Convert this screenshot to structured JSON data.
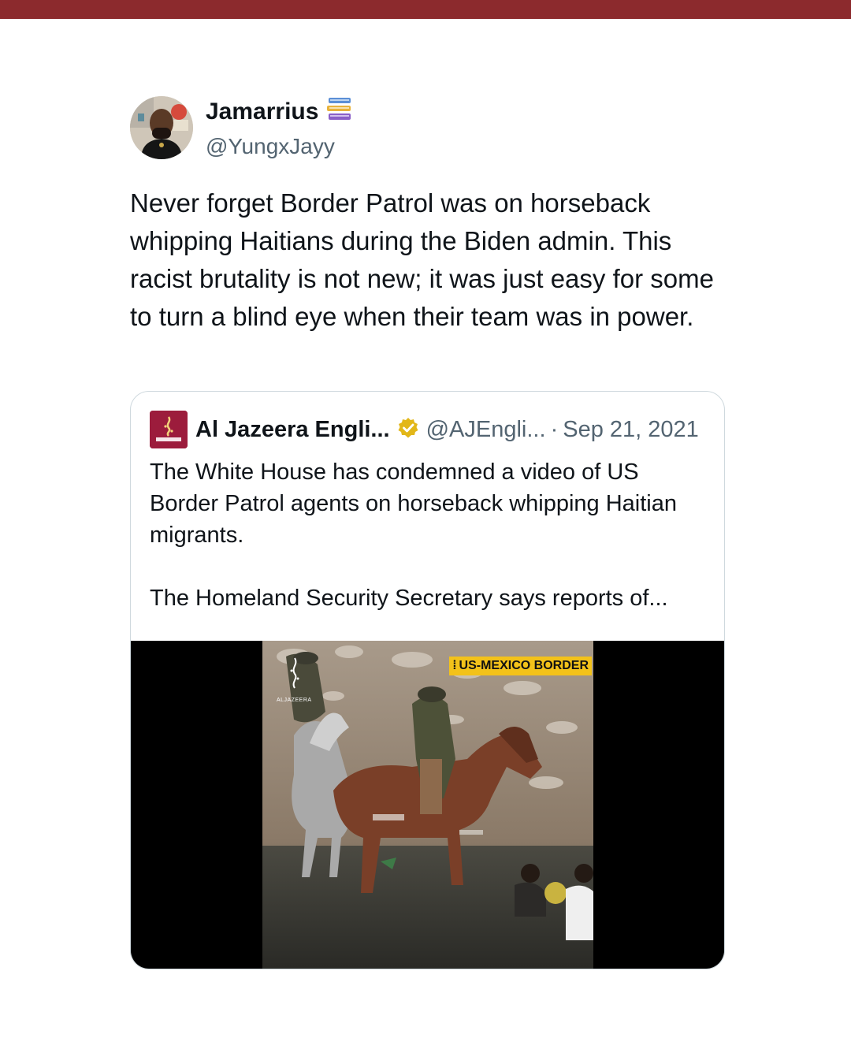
{
  "tweet": {
    "display_name": "Jamarrius",
    "handle": "@YungxJayy",
    "name_emoji": "books-emoji",
    "text": "Never forget Border Patrol was on horseback whipping Haitians during the Biden admin. This racist brutality is not new; it was just easy for some to turn a blind eye when their team was in power."
  },
  "quote": {
    "display_name": "Al Jazeera Engli...",
    "handle": "@AJEngli...",
    "separator": "·",
    "date": "Sep 21, 2021",
    "paragraph_1": "The White House has condemned a video of US Border Patrol agents on horseback whipping Haitian migrants.",
    "paragraph_2": "The Homeland Security Secretary says reports of...",
    "media": {
      "tag_label": "US-MEXICO BORDER",
      "watermark": "ALJAZEERA"
    }
  },
  "colors": {
    "top_bar": "#8c2a2d",
    "verified_gold": "#e2b719",
    "secondary_text": "#536471",
    "tag_yellow": "#f3c21a"
  }
}
